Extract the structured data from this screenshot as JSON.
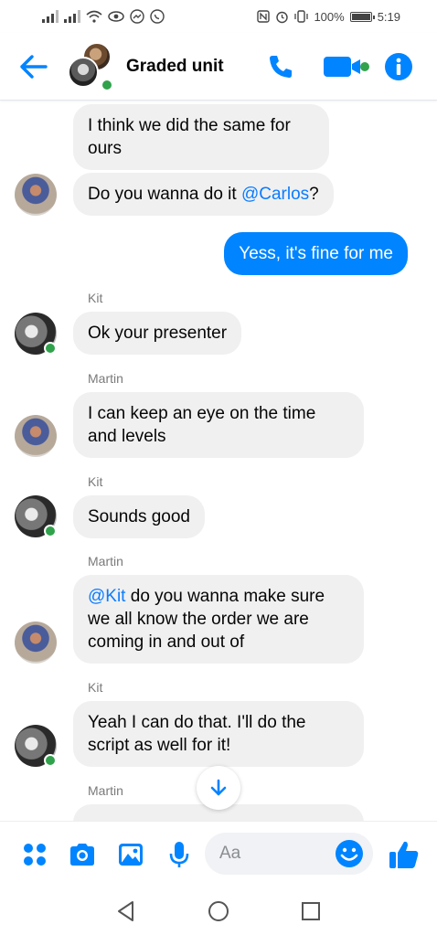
{
  "status_bar": {
    "battery": "100%",
    "time": "5:19"
  },
  "header": {
    "title": "Graded unit"
  },
  "colors": {
    "accent": "#0084ff",
    "mention": "#0a7cff",
    "online": "#31a24c",
    "bubble_other": "#f0f0f0"
  },
  "messages": [
    {
      "sender": "",
      "lines": [
        "I think we did the same for",
        "ours"
      ]
    },
    {
      "sender": "",
      "text_before": "Do you wanna do it ",
      "mention": "@Carlos",
      "text_after": "?"
    },
    {
      "sender": "me",
      "text": "Yess, it's fine for me"
    },
    {
      "sender": "Kit",
      "text": "Ok your presenter"
    },
    {
      "sender": "Martin",
      "lines": [
        "I can keep an eye on the time",
        "and levels"
      ]
    },
    {
      "sender": "Kit",
      "text": "Sounds good"
    },
    {
      "sender": "Martin",
      "mention": "@Kit",
      "line1_rest": " do you wanna make sure",
      "line2": "we all know the order we are",
      "line3": "coming in and out of"
    },
    {
      "sender": "Kit",
      "lines": [
        "Yeah I can do that. I'll do the",
        "script as well for it!"
      ]
    },
    {
      "sender": "Martin"
    }
  ],
  "composer": {
    "placeholder": "Aa",
    "icons": [
      "apps-icon",
      "camera-icon",
      "gallery-icon",
      "microphone-icon",
      "emoji-icon",
      "thumbs-up-icon"
    ]
  },
  "nav": {
    "icons": [
      "back-triangle-icon",
      "home-circle-icon",
      "recents-square-icon"
    ]
  }
}
